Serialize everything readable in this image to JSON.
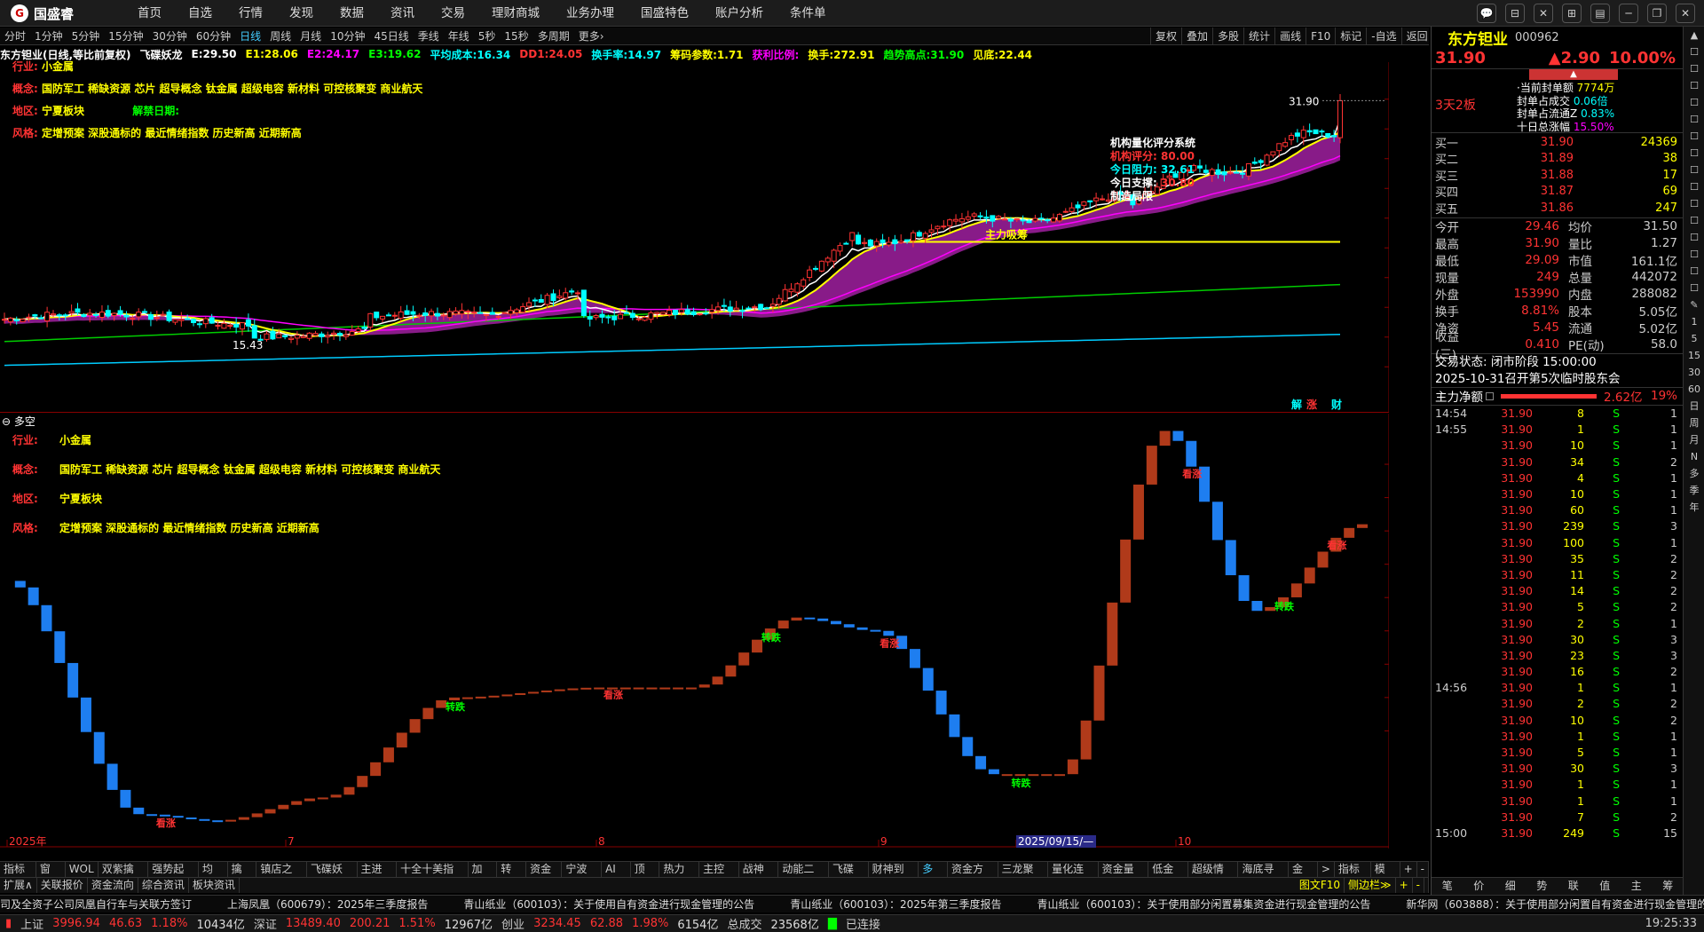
{
  "app": {
    "logo_text": "国盛睿",
    "logo_glyph": "G"
  },
  "menu": [
    "首页",
    "自选",
    "行情",
    "发现",
    "数据",
    "资讯",
    "交易",
    "理财商城",
    "业务办理",
    "国盛特色",
    "账户分析",
    "条件单"
  ],
  "window_buttons": [
    "💬",
    "⊟",
    "✕",
    "⊞",
    "▤",
    "─",
    "❐",
    "✕"
  ],
  "periods": [
    "分时",
    "1分钟",
    "5分钟",
    "15分钟",
    "30分钟",
    "60分钟",
    "日线",
    "周线",
    "月线",
    "10分钟",
    "45日线",
    "季线",
    "年线",
    "5秒",
    "15秒",
    "多周期",
    "更多›"
  ],
  "period_selected": "日线",
  "chart_buttons": [
    "复权",
    "叠加",
    "多股",
    "统计",
    "画线",
    "F10",
    "标记",
    "-自选",
    "返回"
  ],
  "infobar": {
    "stock": "东方钽业(日线,等比前复权)",
    "indicator": "飞碟妖龙",
    "items": [
      {
        "label": "E:",
        "value": "29.50",
        "color": "#fff"
      },
      {
        "label": "E1:",
        "value": "28.06",
        "color": "#ff0"
      },
      {
        "label": "E2:",
        "value": "24.17",
        "color": "#f0f"
      },
      {
        "label": "E3:",
        "value": "19.62",
        "color": "#0f0"
      },
      {
        "label": "平均成本:",
        "value": "16.34",
        "color": "#0ff"
      },
      {
        "label": "DD1:",
        "value": "24.05",
        "color": "#f33"
      },
      {
        "label": "换手率:",
        "value": "14.97",
        "color": "#0ff"
      },
      {
        "label": "筹码参数:",
        "value": "1.71",
        "color": "#ff0"
      },
      {
        "label": "获利比例:",
        "value": "",
        "color": "#f0f"
      },
      {
        "label": "换手:",
        "value": "272.91",
        "color": "#ff0"
      },
      {
        "label": "趋势高点:",
        "value": "31.90",
        "color": "#0f0"
      },
      {
        "label": "见底:",
        "value": "22.44",
        "color": "#ff0"
      }
    ]
  },
  "main_info": {
    "industry_label": "行业:",
    "industry": "小金属",
    "concept_label": "概念:",
    "concept": "国防军工 稀缺资源 芯片 超导概念 钛金属 超级电容 新材料 可控核聚变 商业航天",
    "region_label": "地区:",
    "region": "宁夏板块",
    "lift_label": "解禁日期:",
    "lift": "",
    "style_label": "风格:",
    "style": "定增预案 深股通标的 最近情绪指数 历史新高 近期新高"
  },
  "sub_info": {
    "title": "多空",
    "industry_label": "行业:",
    "industry": "小金属",
    "concept_label": "概念:",
    "concept": "国防军工 稀缺资源 芯片 超导概念 钛金属 超级电容 新材料 可控核聚变 商业航天",
    "region_label": "地区:",
    "region": "宁夏板块",
    "style_label": "风格:",
    "style": "定增预案 深股通标的 最近情绪指数 历史新高 近期新高"
  },
  "inst_panel": {
    "title": "机构量化评分系统",
    "score_label": "机构评分:",
    "score": "80.00",
    "pressure_label": "今日阻力:",
    "pressure": "32.61",
    "support_label": "今日支撑:",
    "support": "30.80",
    "trend": "制造局限"
  },
  "annotations": {
    "high_price": "31.90",
    "low_price": "15.43",
    "main_absorb": "主力吸筹",
    "jie": "解",
    "zhang": "涨",
    "cai": "财"
  },
  "chart_data": [
    {
      "type": "candlestick",
      "title": "东方钽业(日线,等比前复权)",
      "y_ticks": [
        "32.00",
        "30.00",
        "28.00",
        "26.00",
        "24.00",
        "22.00",
        "20.00",
        "18.00",
        "16.00",
        "14.00"
      ],
      "ylim": [
        13.0,
        33.0
      ],
      "last_close": 31.9,
      "low_marked": 15.43
    },
    {
      "type": "bar",
      "title": "多空",
      "y_ticks": [
        "0.80",
        "0.70",
        "0.60",
        "0.50",
        "0.40",
        "0.30",
        "0.20",
        "0.10",
        "0.00"
      ],
      "ylim": [
        -0.3,
        0.92
      ],
      "labels": {
        "turn_down": "转跌",
        "turn_up": "看涨"
      }
    }
  ],
  "x_axis": {
    "labels": [
      "2025年",
      "7",
      "8",
      "9",
      "2025/09/15/—",
      "10"
    ],
    "period": "日线"
  },
  "bottom_tabs1": [
    "指标A",
    "窗口",
    "WOL",
    "双紫擒龙",
    "强势起爆",
    "均线",
    "擒龙",
    "镇店之宝",
    "飞碟妖龙",
    "主进出",
    "十全十美指标",
    "加仓",
    "转点",
    "资金2",
    "宁波敢",
    "AI龙",
    "顶底",
    "热力图",
    "主控盘",
    "战神号",
    "动能二号",
    "飞碟妖",
    "财神到家",
    "多空",
    "资金方向",
    "三龙聚首",
    "量化连板",
    "资金量能",
    "低金叉",
    "超级情绪",
    "海底寻宝",
    "金叉",
    ">",
    "指标B",
    "模板",
    "+",
    "-"
  ],
  "bottom_tabs2": [
    "扩展∧",
    "关联报价",
    "资金流向",
    "综合资讯",
    "板块资讯"
  ],
  "bottom_right": [
    "图文F10",
    "侧边栏≫",
    "+",
    "-"
  ],
  "news": [
    "司及全资子公司凤凰自行车与关联方签订",
    "上海凤凰（600679）：2025年三季度报告",
    "青山纸业（600103）：关于使用自有资金进行现金管理的公告",
    "青山纸业（600103）：2025年第三季度报告",
    "青山纸业（600103）：关于使用部分闲置募集资金进行现金管理的公告",
    "新华网（603888）：关于使用部分闲置自有资金进行现金管理的"
  ],
  "status": {
    "sh_label": "上证",
    "sh": "3996.94",
    "sh_chg": "46.63",
    "sh_pct": "1.18%",
    "sh_amt": "10434亿",
    "sz_label": "深证",
    "sz": "13489.40",
    "sz_chg": "200.21",
    "sz_pct": "1.51%",
    "sz_amt": "12967亿",
    "cy_label": "创业",
    "cy": "3234.45",
    "cy_chg": "62.88",
    "cy_pct": "1.98%",
    "cy_amt": "6154亿",
    "total_label": "总成交",
    "total": "23568亿",
    "conn": "已连接",
    "time": "19:25:33"
  },
  "quote": {
    "name": "东方钽业",
    "code": "000962",
    "price": "31.90",
    "change": "▲2.90",
    "pct": "10.00%",
    "streak": "3天2板",
    "seal_amount_label": "当前封单额",
    "seal_amount": "7774万",
    "seal_vol_label": "封单占成交",
    "seal_vol": "0.06倍",
    "seal_float_label": "封单占流通Z",
    "seal_float": "0.83%",
    "ten_day_label": "十日总涨幅",
    "ten_day": "15.50%",
    "buys": [
      {
        "l": "买一",
        "p": "31.90",
        "v": "24369"
      },
      {
        "l": "买二",
        "p": "31.89",
        "v": "38"
      },
      {
        "l": "买三",
        "p": "31.88",
        "v": "17"
      },
      {
        "l": "买四",
        "p": "31.87",
        "v": "69"
      },
      {
        "l": "买五",
        "p": "31.86",
        "v": "247"
      }
    ],
    "stats": [
      {
        "k": "今开",
        "a": "29.46",
        "k2": "均价",
        "b": "31.50"
      },
      {
        "k": "最高",
        "a": "31.90",
        "k2": "量比",
        "b": "1.27"
      },
      {
        "k": "最低",
        "a": "29.09",
        "k2": "市值",
        "b": "161.1亿"
      },
      {
        "k": "现量",
        "a": "249",
        "k2": "总量",
        "b": "442072"
      },
      {
        "k": "外盘",
        "a": "153990",
        "k2": "内盘",
        "b": "288082"
      },
      {
        "k": "换手",
        "a": "8.81%",
        "k2": "股本",
        "b": "5.05亿"
      },
      {
        "k": "净资",
        "a": "5.45",
        "k2": "流通",
        "b": "5.02亿"
      },
      {
        "k": "收益(三)",
        "a": "0.410",
        "k2": "PE(动)",
        "b": "58.0"
      }
    ],
    "trade_state": "交易状态: 闭市阶段 15:00:00",
    "meeting": "2025-10-31召开第5次临时股东会",
    "net_flow_label": "主力净额",
    "net_flow": "2.62亿",
    "net_pct": "19%",
    "ticks": [
      {
        "t": "14:54",
        "p": "31.90",
        "v": "8",
        "s": "S",
        "n": "1"
      },
      {
        "t": "14:55",
        "p": "31.90",
        "v": "1",
        "s": "S",
        "n": "1"
      },
      {
        "t": "",
        "p": "31.90",
        "v": "10",
        "s": "S",
        "n": "1"
      },
      {
        "t": "",
        "p": "31.90",
        "v": "34",
        "s": "S",
        "n": "2"
      },
      {
        "t": "",
        "p": "31.90",
        "v": "4",
        "s": "S",
        "n": "1"
      },
      {
        "t": "",
        "p": "31.90",
        "v": "10",
        "s": "S",
        "n": "1"
      },
      {
        "t": "",
        "p": "31.90",
        "v": "60",
        "s": "S",
        "n": "1"
      },
      {
        "t": "",
        "p": "31.90",
        "v": "239",
        "s": "S",
        "n": "3"
      },
      {
        "t": "",
        "p": "31.90",
        "v": "100",
        "s": "S",
        "n": "1"
      },
      {
        "t": "",
        "p": "31.90",
        "v": "35",
        "s": "S",
        "n": "2"
      },
      {
        "t": "",
        "p": "31.90",
        "v": "11",
        "s": "S",
        "n": "2"
      },
      {
        "t": "",
        "p": "31.90",
        "v": "14",
        "s": "S",
        "n": "2"
      },
      {
        "t": "",
        "p": "31.90",
        "v": "5",
        "s": "S",
        "n": "2"
      },
      {
        "t": "",
        "p": "31.90",
        "v": "2",
        "s": "S",
        "n": "1"
      },
      {
        "t": "",
        "p": "31.90",
        "v": "30",
        "s": "S",
        "n": "3"
      },
      {
        "t": "",
        "p": "31.90",
        "v": "23",
        "s": "S",
        "n": "3"
      },
      {
        "t": "",
        "p": "31.90",
        "v": "16",
        "s": "S",
        "n": "2"
      },
      {
        "t": "14:56",
        "p": "31.90",
        "v": "1",
        "s": "S",
        "n": "1"
      },
      {
        "t": "",
        "p": "31.90",
        "v": "2",
        "s": "S",
        "n": "2"
      },
      {
        "t": "",
        "p": "31.90",
        "v": "10",
        "s": "S",
        "n": "2"
      },
      {
        "t": "",
        "p": "31.90",
        "v": "1",
        "s": "S",
        "n": "1"
      },
      {
        "t": "",
        "p": "31.90",
        "v": "5",
        "s": "S",
        "n": "1"
      },
      {
        "t": "",
        "p": "31.90",
        "v": "30",
        "s": "S",
        "n": "3"
      },
      {
        "t": "",
        "p": "31.90",
        "v": "1",
        "s": "S",
        "n": "1"
      },
      {
        "t": "",
        "p": "31.90",
        "v": "1",
        "s": "S",
        "n": "1"
      },
      {
        "t": "",
        "p": "31.90",
        "v": "7",
        "s": "S",
        "n": "2"
      },
      {
        "t": "15:00",
        "p": "31.90",
        "v": "249",
        "s": "S",
        "n": "15"
      }
    ],
    "bottom_tabs": [
      "笔",
      "价",
      "细",
      "势",
      "联",
      "值",
      "主",
      "筹"
    ]
  },
  "side_tools": [
    "▲",
    "☐",
    "☐",
    "☐",
    "☐",
    "☐",
    "☐",
    "☐",
    "☐",
    "☐",
    "☐",
    "☐",
    "☐",
    "☐",
    "☐",
    "☐",
    "✎",
    "1",
    "5",
    "15",
    "30",
    "60",
    "日",
    "周",
    "月",
    "N",
    "多",
    "季",
    "年"
  ]
}
